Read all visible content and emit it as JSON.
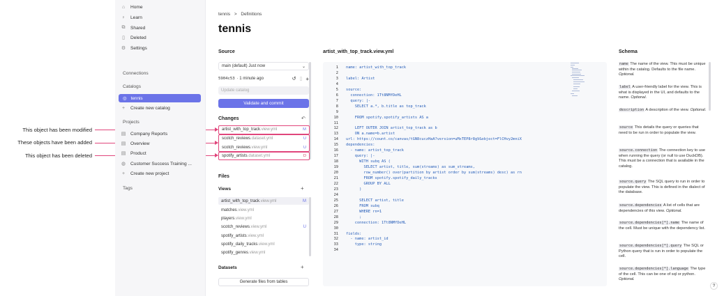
{
  "annotations": {
    "modified": "This object has been modified",
    "added": "These objects have been added",
    "deleted": "This object has been deleted"
  },
  "sidebar": {
    "nav": [
      {
        "label": "Home",
        "icon": "home-icon"
      },
      {
        "label": "Learn",
        "icon": "bulb-icon"
      },
      {
        "label": "Shared",
        "icon": "shared-icon"
      },
      {
        "label": "Deleted",
        "icon": "trash-icon"
      },
      {
        "label": "Settings",
        "icon": "gear-icon"
      }
    ],
    "connections_label": "Connections",
    "catalogs_label": "Catalogs",
    "catalog_active": "tennis",
    "create_catalog": "Create new catalog",
    "projects_label": "Projects",
    "projects": [
      "Company Reports",
      "Overview",
      "Product",
      "Customer Success Training ..."
    ],
    "create_project": "Create new project",
    "tags_label": "Tags"
  },
  "breadcrumb": {
    "root": "tennis",
    "sep": ">",
    "current": "Definitions"
  },
  "page_title": "tennis",
  "source": {
    "heading": "Source",
    "branch": "main (default) Just now",
    "commit_hash": "5904c53",
    "commit_time": "· 1 minute ago",
    "update_placeholder": "Update catalog",
    "validate_label": "Validate and commit",
    "changes_heading": "Changes",
    "changes": [
      {
        "name": "artist_with_top_track",
        "ext": ".view.yml",
        "status": "M"
      },
      {
        "name": "scotch_reviews",
        "ext": ".dataset.yml",
        "status": "U"
      },
      {
        "name": "scotch_reviews",
        "ext": ".view.yml",
        "status": "U"
      },
      {
        "name": "spotify_artists",
        "ext": ".dataset.yml",
        "status": "D"
      }
    ]
  },
  "files": {
    "heading": "Files",
    "views_heading": "Views",
    "views": [
      {
        "name": "artist_with_top_track",
        "ext": ".view.yml",
        "status": "M"
      },
      {
        "name": "matches",
        "ext": ".view.yml",
        "status": ""
      },
      {
        "name": "players",
        "ext": ".view.yml",
        "status": ""
      },
      {
        "name": "scotch_reviews",
        "ext": ".view.yml",
        "status": "U"
      },
      {
        "name": "spotify_artists",
        "ext": ".view.yml",
        "status": ""
      },
      {
        "name": "spotify_daily_tracks",
        "ext": ".view.yml",
        "status": ""
      },
      {
        "name": "spotify_genres",
        "ext": ".view.yml",
        "status": ""
      }
    ],
    "datasets_heading": "Datasets",
    "generate_label": "Generate files from tables"
  },
  "editor": {
    "filename": "artist_with_top_track.view.yml",
    "lines": [
      "name: artist_with_top_track",
      "",
      "label: Artist",
      "",
      "source:",
      "  connection: 1Tt8NMfDeHL",
      "  query: |-",
      "    SELECT a.*, b.title as top_track",
      "",
      "    FROM spotify.spotify_artists AS a",
      "",
      "    LEFT OUTER JOIN artist_top_track as b",
      "    ON a.name=b.artist",
      "url: https://count.co/canvas/tGN8cuczHaA?version=uMxTEP8r8gV&object=FlCHvy2mniX",
      "dependencies:",
      "  - name: artist_top_track",
      "    query: |-",
      "      WITH subq AS (",
      "        SELECT artist, title, sum(streams) as sum_streams,",
      "        row_number() over(partition by artist order by sum(streams) desc) as rn",
      "        FROM spotify.spotify_daily_tracks",
      "        GROUP BY ALL",
      "      )",
      "",
      "      SELECT artist, title",
      "      FROM subq",
      "      WHERE rn=1",
      "      ;",
      "    connection: 1Tt8NMfDeHL",
      "",
      "fields:",
      "  - name: artist_id",
      "    type: string",
      ""
    ]
  },
  "schema": {
    "heading": "Schema",
    "items": [
      {
        "key": "name",
        "text": "The name of the view. This must be unique within the catalog. Defaults to the file name.",
        "note": "Optional."
      },
      {
        "key": "label",
        "text": "A user-friendly label for the view. This is what is displayed in the UI, and defaults to the name.",
        "note": "Optional."
      },
      {
        "key": "description",
        "text": "A description of the view.",
        "note": "Optional."
      },
      {
        "key": "source",
        "text": "This details the query or queries that need to be run in order to populate the view.",
        "note": ""
      },
      {
        "key": "source.connection",
        "text": "The connection key to use when running the query (or null to use DuckDB). This must be a connection that is available in the catalog.",
        "note": ""
      },
      {
        "key": "source.query",
        "text": "The SQL query to run in order to populate the view. This is defined in the dialect of the database.",
        "note": ""
      },
      {
        "key": "source.dependencies",
        "text": "A list of cells that are dependencies of this view.",
        "note": "Optional."
      },
      {
        "key": "source.dependencies[*].name",
        "text": "The name of the cell. Must be unique with the dependency list.",
        "note": ""
      },
      {
        "key": "source.dependencies[*].query",
        "text": "The SQL or Python query that is run in order to populate the cell.",
        "note": ""
      },
      {
        "key": "source.dependencies[*].language",
        "text": "The type of the cell. This can be one of sql or python.",
        "note": "Optional."
      }
    ]
  },
  "help_label": "?",
  "colors": {
    "accent": "#6b73e8",
    "highlight": "#e0457b",
    "code": "#245cb8"
  }
}
